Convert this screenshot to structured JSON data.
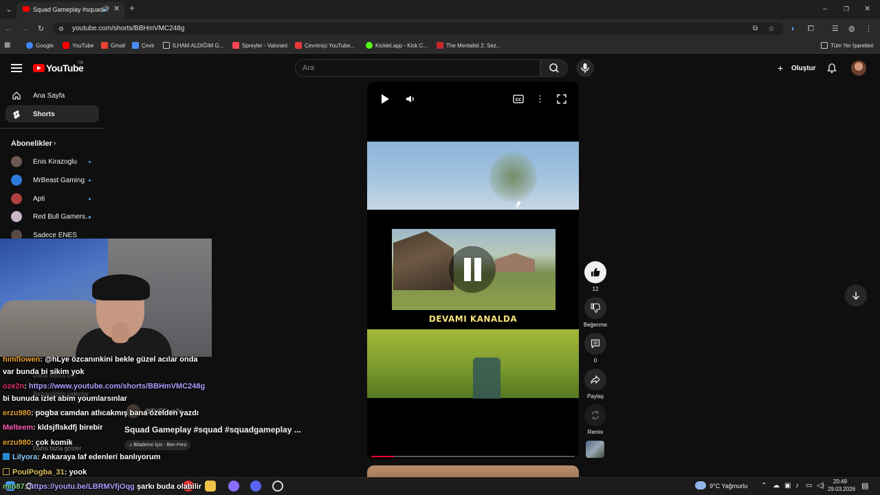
{
  "browser": {
    "tab_title": "Squad Gameplay #squad #",
    "url": "youtube.com/shorts/BBHmVMC248g",
    "bookmarks": [
      {
        "label": "Google",
        "color": "#4285f4"
      },
      {
        "label": "YouTube",
        "color": "#ff0000"
      },
      {
        "label": "Gmail",
        "color": "#ea4335"
      },
      {
        "label": "Çevir",
        "color": "#4c8bf5"
      },
      {
        "label": "İLHAM ALDIĞIM G...",
        "color": "#c8c8c8"
      },
      {
        "label": "Spreyler - Valorant",
        "color": "#ff4655"
      },
      {
        "label": "Çevrimiçi YouTube...",
        "color": "#e53935"
      },
      {
        "label": "Kicklet.app - Kick C...",
        "color": "#53fc18"
      },
      {
        "label": "The Mentalist 2. Sez...",
        "color": "#c62828"
      }
    ],
    "all_bookmarks": "Tüm Yer İşaretleri"
  },
  "youtube": {
    "logo_text": "YouTube",
    "logo_region": "TR",
    "search_placeholder": "Ara",
    "create_label": "Oluştur"
  },
  "sidebar": {
    "items": [
      {
        "label": "Ana Sayfa",
        "icon": "home-icon"
      },
      {
        "label": "Shorts",
        "icon": "shorts-icon",
        "active": true
      }
    ],
    "subscriptions_title": "Abonelikler",
    "subscriptions": [
      {
        "label": "Enis Kirazoglu",
        "color": "#6b5a52"
      },
      {
        "label": "MrBeast Gaming",
        "color": "#2f7bd9"
      },
      {
        "label": "Apti",
        "color": "#b0413e"
      },
      {
        "label": "Red Bull Gamers...",
        "color": "#c9b6c7"
      },
      {
        "label": "Sadece ENES",
        "color": "#5a4a42"
      }
    ],
    "hidden_items": [
      "Daha sonra izle",
      "Beğendiğim videolar",
      "Videolarınız",
      "Daha fazla göster"
    ]
  },
  "short": {
    "overlay_text": "DEVAMI KANALDA",
    "title": "Squad Gameplay #squad #squadgameplay ...",
    "channel": "@THEFero2n",
    "music": "Biladerim İçin · Ben Fero",
    "progress": 0.11
  },
  "actions": {
    "likes": "12",
    "dislike_label": "Beğenme",
    "comments": "0",
    "share_label": "Paylaş",
    "remix_label": "Remix"
  },
  "chat": [
    {
      "user": "himflowen",
      "color": "#f0a030",
      "text": ": @hLye özcanınkini bekle güzel acılar onda"
    },
    {
      "user": "",
      "color": "#ffffff",
      "text": "var bunda bi sikim yok"
    },
    {
      "user": "oze2n",
      "color": "#e0306a",
      "text": ": ",
      "link": "https://www.youtube.com/shorts/BBHmVMC248g"
    },
    {
      "user": "",
      "color": "#ffffff",
      "text": "bi bunuda izlet abim youmlarsınlar"
    },
    {
      "user": "erzu980",
      "color": "#e0a030",
      "text": ": pogba camdan atlıcakmış bana özelden yazdı"
    },
    {
      "user": "Melteem",
      "color": "#ff5db3",
      "text": ": kldsjflskdfj birebir"
    },
    {
      "user": "erzu980",
      "color": "#e0a030",
      "text": ": çok komik"
    },
    {
      "user": "Lilyora",
      "color": "#8fd3ff",
      "text": ": Ankaraya laf edenleri banlıyorum"
    },
    {
      "user": "PoulPogba_31",
      "color": "#e0c060",
      "text": ": yook"
    },
    {
      "user": "mio87",
      "color": "#7fd37f",
      "text": ": ",
      "link": "https://youtu.be/LBRMVfjOqg",
      "tail": " şarkı buda olabilir"
    }
  ],
  "taskbar": {
    "weather": "9°C  Yağmurlu",
    "time": "20:49",
    "date": "29.03.2026"
  }
}
